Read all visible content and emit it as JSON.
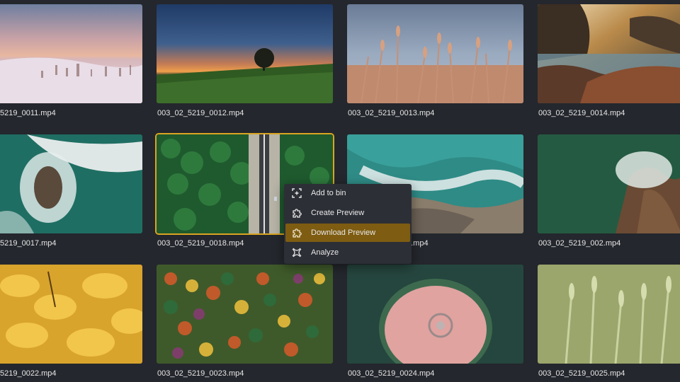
{
  "gallery": {
    "tiles": [
      {
        "label": "5219_0011.mp4",
        "scene": "snowy-field-sunset"
      },
      {
        "label": "003_02_5219_0012.mp4",
        "scene": "tree-hill-sunset"
      },
      {
        "label": "003_02_5219_0013.mp4",
        "scene": "wheat-sky"
      },
      {
        "label": "003_02_5219_0014.mp4",
        "scene": "rocky-coast-sunlight"
      },
      {
        "label": "5219_0017.mp4",
        "scene": "aerial-sea-rock"
      },
      {
        "label": "003_02_5219_0018.mp4",
        "scene": "forest-road-aerial"
      },
      {
        "label": "9.mp4",
        "scene": "aerial-coastline"
      },
      {
        "label": "003_02_5219_002.mp4",
        "scene": "cliff-waves"
      },
      {
        "label": "5219_0022.mp4",
        "scene": "yellow-leaves"
      },
      {
        "label": "003_02_5219_0023.mp4",
        "scene": "autumn-forest-aerial"
      },
      {
        "label": "003_02_5219_0024.mp4",
        "scene": "round-island-aerial"
      },
      {
        "label": "003_02_5219_0025.mp4",
        "scene": "green-wheat"
      }
    ],
    "selected_index": 5
  },
  "context_menu": {
    "items": [
      {
        "label": "Add to bin",
        "icon": "add-to-bin-icon"
      },
      {
        "label": "Create Preview",
        "icon": "puzzle-icon"
      },
      {
        "label": "Download Preview",
        "icon": "puzzle-download-icon"
      },
      {
        "label": "Analyze",
        "icon": "analyze-icon"
      }
    ],
    "highlighted_index": 2
  },
  "colors": {
    "background": "#24272d",
    "selection": "#d9a521",
    "menu_background": "#2c2f36",
    "menu_highlight": "#7e5c11"
  }
}
